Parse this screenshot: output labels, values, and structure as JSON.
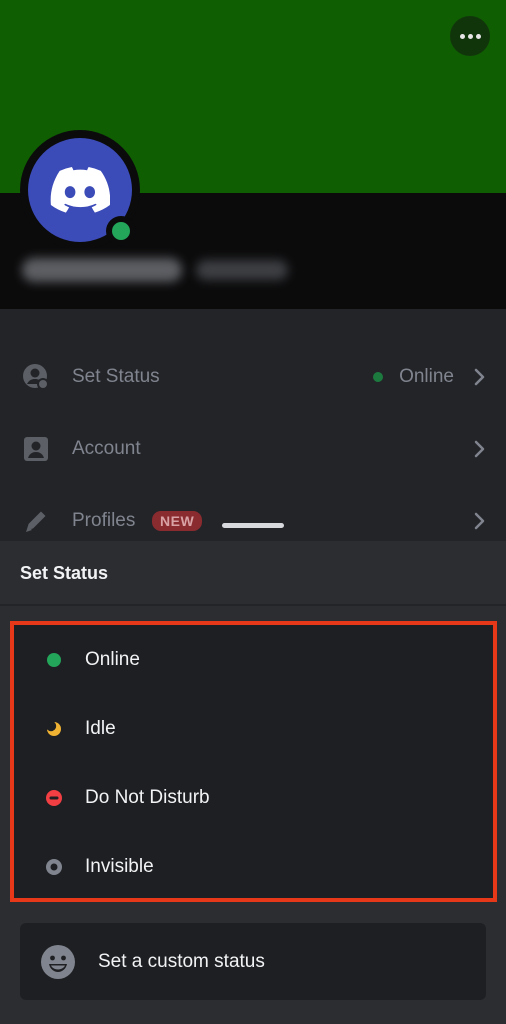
{
  "colors": {
    "banner": "#0f5e02",
    "online": "#23a55a",
    "idle": "#f0b232",
    "dnd": "#f23f43",
    "invisible": "#80848e",
    "highlight_border": "#e8381a"
  },
  "profile": {
    "avatar_icon": "discord-logo-icon",
    "username": "",
    "tag": ""
  },
  "menu": {
    "set_status": {
      "label": "Set Status",
      "value": "Online",
      "icon": "user-status-icon"
    },
    "account": {
      "label": "Account",
      "icon": "account-card-icon"
    },
    "profiles": {
      "label": "Profiles",
      "badge": "NEW",
      "icon": "pencil-icon"
    }
  },
  "sheet": {
    "title": "Set Status",
    "statuses": [
      {
        "label": "Online",
        "icon": "online-dot-icon"
      },
      {
        "label": "Idle",
        "icon": "idle-moon-icon"
      },
      {
        "label": "Do Not Disturb",
        "icon": "dnd-icon"
      },
      {
        "label": "Invisible",
        "icon": "invisible-ring-icon"
      }
    ],
    "custom": {
      "label": "Set a custom status",
      "icon": "smiley-icon"
    }
  }
}
